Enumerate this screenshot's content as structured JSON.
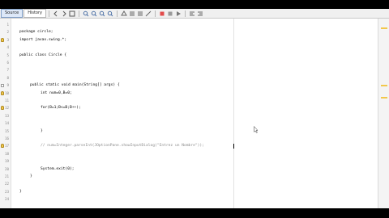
{
  "toolbar": {
    "tabs": [
      {
        "label": "Source",
        "active": true
      },
      {
        "label": "History",
        "active": false
      }
    ],
    "icons": [
      "back-icon",
      "forward-icon",
      "toggle-icon",
      "find-prev-icon",
      "find-next-icon",
      "find-icon",
      "zoom-in-icon",
      "zoom-out-icon",
      "search-icon",
      "shift-left-icon",
      "shift-right-icon",
      "comment-icon",
      "uncomment-icon",
      "bookmark-icon",
      "record-icon",
      "stop-icon",
      "play-icon",
      "comment-toggle-icon",
      "diff-icon"
    ]
  },
  "editor": {
    "lines": [
      {
        "num": "1",
        "html": ""
      },
      {
        "num": "2",
        "text": "package circle;"
      },
      {
        "num": "3",
        "text": "import javax.swing.*;",
        "marker": "bulb"
      },
      {
        "num": "4",
        "text": ""
      },
      {
        "num": "5",
        "text": "public class Circle {"
      },
      {
        "num": "6",
        "text": ""
      },
      {
        "num": "7",
        "text": ""
      },
      {
        "num": "8",
        "text": ""
      },
      {
        "num": "9",
        "text": "public static void main(String[] args) {",
        "marker": "fold"
      },
      {
        "num": "10",
        "text": "int num=0,B=0;",
        "marker": "bulb"
      },
      {
        "num": "11",
        "text": ""
      },
      {
        "num": "12",
        "text": "for(B=1;B<=B;B++);",
        "marker": "bulb"
      },
      {
        "num": "13",
        "text": ""
      },
      {
        "num": "14",
        "text": ""
      },
      {
        "num": "15",
        "text": "}"
      },
      {
        "num": "16",
        "text": ""
      },
      {
        "num": "17",
        "text": "// num=Integer.parseInt(JOptionPane.showInputDialog(\"Entrez un Nombre\"));",
        "marker": "bulb"
      },
      {
        "num": "18",
        "text": ""
      },
      {
        "num": "19",
        "text": ""
      },
      {
        "num": "20",
        "text": "System.exit(0);"
      },
      {
        "num": "21",
        "text": "}"
      },
      {
        "num": "22",
        "text": ""
      },
      {
        "num": "23",
        "text": "}"
      },
      {
        "num": "24",
        "text": ""
      }
    ]
  },
  "colors": {
    "keyword": "#00008b",
    "comment": "#8a8a8a",
    "background": "#ffffff"
  }
}
